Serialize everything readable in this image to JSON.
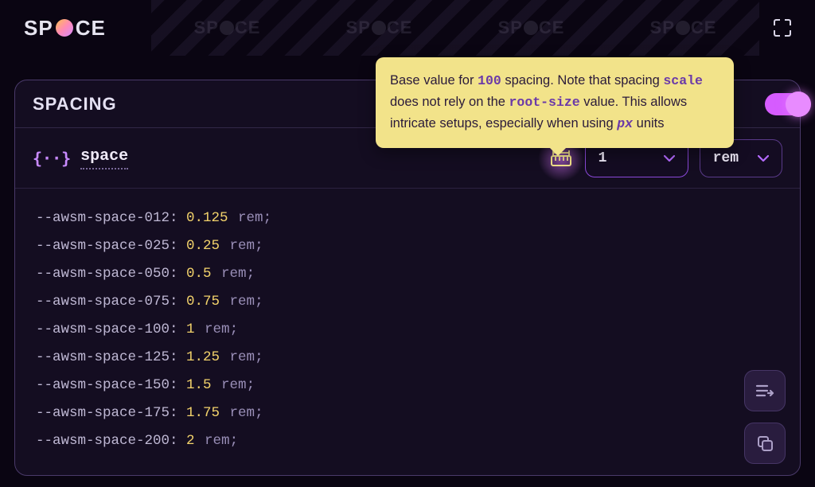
{
  "brand": {
    "prefix": "SP",
    "suffix": "CE"
  },
  "panel": {
    "title": "SPACING",
    "token_name": "space",
    "base_value": "1",
    "unit": "rem"
  },
  "tooltip": {
    "t1": "Base value for ",
    "k1": "100",
    "t2": " spacing. Note that spacing ",
    "k2": "scale",
    "t3": " does not rely on the ",
    "k3": "root-size",
    "t4": " value. This allows intricate setups, especially when using ",
    "k4": "px",
    "t5": " units"
  },
  "tokens": [
    {
      "name": "--awsm-space-012",
      "value": "0.125",
      "unit": "rem"
    },
    {
      "name": "--awsm-space-025",
      "value": "0.25",
      "unit": "rem"
    },
    {
      "name": "--awsm-space-050",
      "value": "0.5",
      "unit": "rem"
    },
    {
      "name": "--awsm-space-075",
      "value": "0.75",
      "unit": "rem"
    },
    {
      "name": "--awsm-space-100",
      "value": "1",
      "unit": "rem"
    },
    {
      "name": "--awsm-space-125",
      "value": "1.25",
      "unit": "rem"
    },
    {
      "name": "--awsm-space-150",
      "value": "1.5",
      "unit": "rem"
    },
    {
      "name": "--awsm-space-175",
      "value": "1.75",
      "unit": "rem"
    },
    {
      "name": "--awsm-space-200",
      "value": "2",
      "unit": "rem"
    }
  ]
}
